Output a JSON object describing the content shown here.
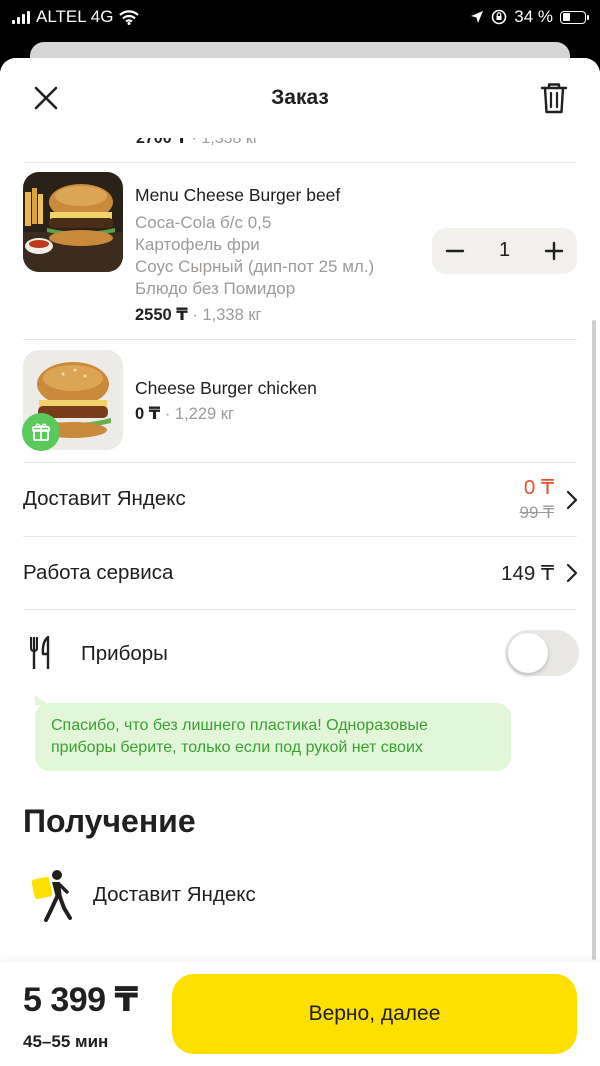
{
  "status_bar": {
    "carrier": "ALTEL 4G",
    "battery": "34 %"
  },
  "header": {
    "title": "Заказ"
  },
  "cut_item": {
    "price": "2700 ₸",
    "weight": "· 1,338 кг"
  },
  "items": [
    {
      "name": "Menu Cheese Burger beef",
      "options": [
        "Coca-Cola б/с 0,5",
        "Картофель фри",
        "Соус Сырный (дип-пот 25 мл.)",
        "Блюдо без Помидор"
      ],
      "price": "2550 ₸",
      "weight": "· 1,338 кг",
      "quantity": "1"
    },
    {
      "name": "Cheese Burger chicken",
      "price": "0 ₸",
      "weight": "· 1,229 кг"
    }
  ],
  "delivery": {
    "label": "Доставит Яндекс",
    "price": "0 ₸",
    "old_price": "99 ₸"
  },
  "service": {
    "label": "Работа сервиса",
    "price": "149 ₸"
  },
  "cutlery": {
    "label": "Приборы",
    "enabled": false
  },
  "tip": "Спасибо, что без лишнего пластика! Одноразовые приборы берите, только если под рукой нет своих",
  "receiving": {
    "title": "Получение",
    "method": "Доставит Яндекс"
  },
  "footer": {
    "total": "5 399 ₸",
    "eta": "45–55 мин",
    "cta_label": "Верно, далее"
  },
  "colors": {
    "accent": "#fce000",
    "discount": "#e8502f",
    "tip_bg": "#e2f6d8",
    "tip_text": "#3aa035"
  },
  "icons": [
    "close-icon",
    "trash-icon",
    "minus-icon",
    "plus-icon",
    "gift-icon",
    "chevron-right-icon",
    "cutlery-icon",
    "courier-icon"
  ]
}
